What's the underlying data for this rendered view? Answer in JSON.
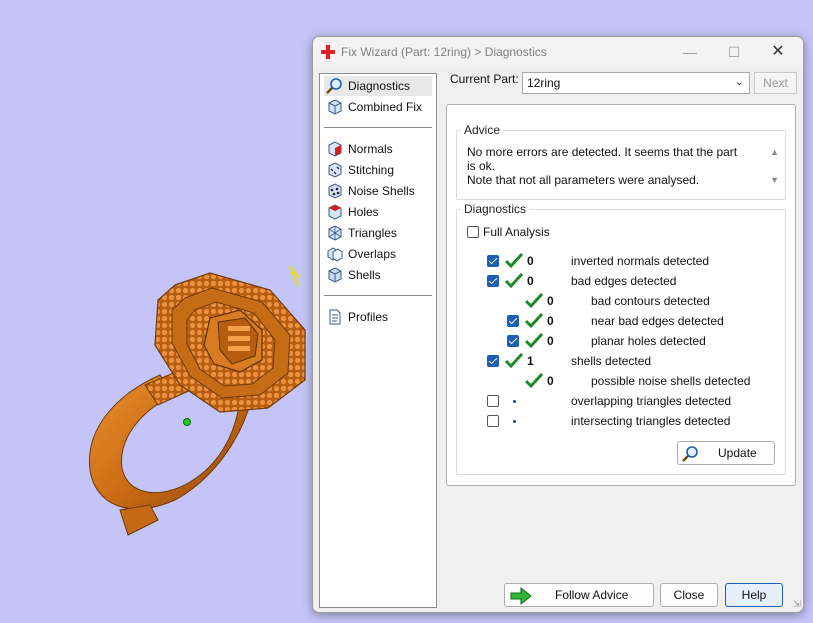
{
  "dialog": {
    "title": "Fix Wizard (Part: 12ring) > Diagnostics",
    "current_part_label": "Current Part:",
    "current_part_value": "12ring",
    "next_label": "Next"
  },
  "nav": {
    "items": [
      {
        "label": "Diagnostics",
        "icon": "magnifier-icon",
        "selected": true
      },
      {
        "label": "Combined Fix",
        "icon": "cube-icon"
      },
      {
        "label": "Normals",
        "icon": "cube-red-face-icon"
      },
      {
        "label": "Stitching",
        "icon": "cube-stitch-icon"
      },
      {
        "label": "Noise Shells",
        "icon": "cube-dots-icon"
      },
      {
        "label": "Holes",
        "icon": "cube-hole-icon"
      },
      {
        "label": "Triangles",
        "icon": "triangle-mesh-icon"
      },
      {
        "label": "Overlaps",
        "icon": "overlap-cube-icon"
      },
      {
        "label": "Shells",
        "icon": "shells-icon"
      },
      {
        "label": "Profiles",
        "icon": "document-icon"
      }
    ]
  },
  "advice": {
    "title": "Advice",
    "line1": "No more errors are detected. It seems that the part is ok.",
    "line2": "Note that not all parameters were analysed."
  },
  "diagnostics": {
    "title": "Diagnostics",
    "full_analysis_label": "Full Analysis",
    "rows": [
      {
        "count": "0",
        "label": "inverted normals detected",
        "checked": true
      },
      {
        "count": "0",
        "label": "bad edges detected",
        "checked": true
      },
      {
        "count": "0",
        "label": "bad contours detected"
      },
      {
        "count": "0",
        "label": "near bad edges detected",
        "checked": true
      },
      {
        "count": "0",
        "label": "planar holes detected",
        "checked": true
      },
      {
        "count": "1",
        "label": "shells detected",
        "checked": true
      },
      {
        "count": "0",
        "label": "possible noise shells detected"
      },
      {
        "label": "overlapping triangles detected",
        "checked": false
      },
      {
        "label": "intersecting triangles detected",
        "checked": false
      }
    ],
    "update_label": "Update"
  },
  "footer": {
    "follow_advice_label": "Follow Advice",
    "close_label": "Close",
    "help_label": "Help"
  },
  "colors": {
    "background": "#c4c4f8",
    "ring_gold": "#d4781c",
    "check_green": "#1f8a2a",
    "accent_blue": "#1a5fb4"
  }
}
